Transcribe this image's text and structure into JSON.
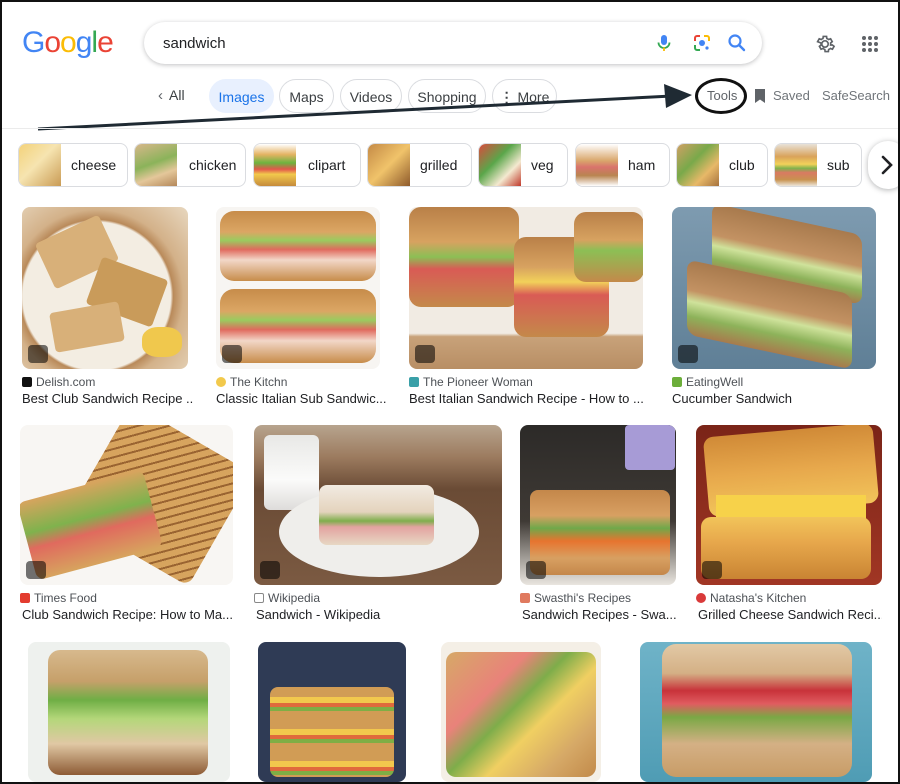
{
  "logo": {
    "letters": [
      "G",
      "o",
      "o",
      "g",
      "l",
      "e"
    ],
    "colors": [
      "#4285F4",
      "#EA4335",
      "#FBBC05",
      "#4285F4",
      "#34A853",
      "#EA4335"
    ]
  },
  "search": {
    "value": "sandwich"
  },
  "nav": {
    "back_all": "All",
    "tabs": [
      "Images",
      "Maps",
      "Videos",
      "Shopping",
      "More"
    ],
    "tools": "Tools",
    "saved": "Saved",
    "safesearch": "SafeSearch"
  },
  "chips": [
    "cheese",
    "chicken",
    "clipart",
    "grilled",
    "veg",
    "ham",
    "club",
    "sub"
  ],
  "results": [
    {
      "source": "Delish.com",
      "title": "Best Club Sandwich Recipe ..."
    },
    {
      "source": "The Kitchn",
      "title": "Classic Italian Sub Sandwic..."
    },
    {
      "source": "The Pioneer Woman",
      "title": "Best Italian Sandwich Recipe - How to ..."
    },
    {
      "source": "EatingWell",
      "title": "Cucumber Sandwich"
    },
    {
      "source": "Times Food",
      "title": "Club Sandwich Recipe: How to Ma..."
    },
    {
      "source": "Wikipedia",
      "title": "Sandwich - Wikipedia"
    },
    {
      "source": "Swasthi's Recipes",
      "title": "Sandwich Recipes - Swa..."
    },
    {
      "source": "Natasha's Kitchen",
      "title": "Grilled Cheese Sandwich Reci..."
    }
  ],
  "colors": {
    "accent": "#1a73e8",
    "active_pill_bg": "#e8f0fe",
    "annotation": "#111111"
  }
}
